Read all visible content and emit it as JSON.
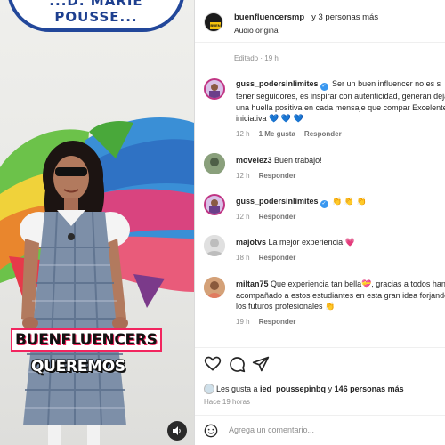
{
  "media": {
    "sign_text": "...D. MARIE POUSSE...",
    "overlay_line1": "BUENFLUENCERS",
    "overlay_line2": "QUEREMOS",
    "audio_icon": "speaker-icon"
  },
  "header": {
    "username": "buenfluencersmp_",
    "coauthors": " y 3 personas más",
    "subtitle": "Audio original",
    "avatar_badge": "BUEN"
  },
  "edited": "Editado · 19 h",
  "comments": [
    {
      "user": "guss_podersinlimites",
      "verified": true,
      "text": "Ser un buen influencer no es s tener seguidores, es inspirar con autenticidad, generan dejar una huella positiva en cada mensaje que compar Excelente iniciativa",
      "emoji": "💙 💙 💙",
      "time": "12 h",
      "likes": "1 Me gusta",
      "reply": "Responder"
    },
    {
      "user": "movelez3",
      "verified": false,
      "text": "Buen trabajo!",
      "time": "12 h",
      "reply": "Responder"
    },
    {
      "user": "guss_podersinlimites",
      "verified": true,
      "text": "",
      "emoji": "👏 👏 👏",
      "time": "12 h",
      "reply": "Responder"
    },
    {
      "user": "majotvs",
      "verified": false,
      "text": "La mejor experiencia",
      "emoji": "💗",
      "time": "18 h",
      "reply": "Responder"
    },
    {
      "user": "miltan75",
      "verified": false,
      "text": "Que experiencia tan bella💝, gracias a todos han acompañado a estos estudiantes en esta gran idea forjando los futuros profesionales",
      "emoji": "👏",
      "time": "19 h",
      "reply": "Responder"
    }
  ],
  "likes": {
    "prefix": "Les gusta a ",
    "user": "ied_poussepinbq",
    "connector": " y ",
    "count": "146 personas más"
  },
  "time_ago": "Hace 19 horas",
  "add_comment": {
    "placeholder": "Agrega un comentario..."
  },
  "colors": {
    "verified": "#3897f0",
    "overlay_border": "#f2255f",
    "link_gray": "#8e8e8e"
  }
}
